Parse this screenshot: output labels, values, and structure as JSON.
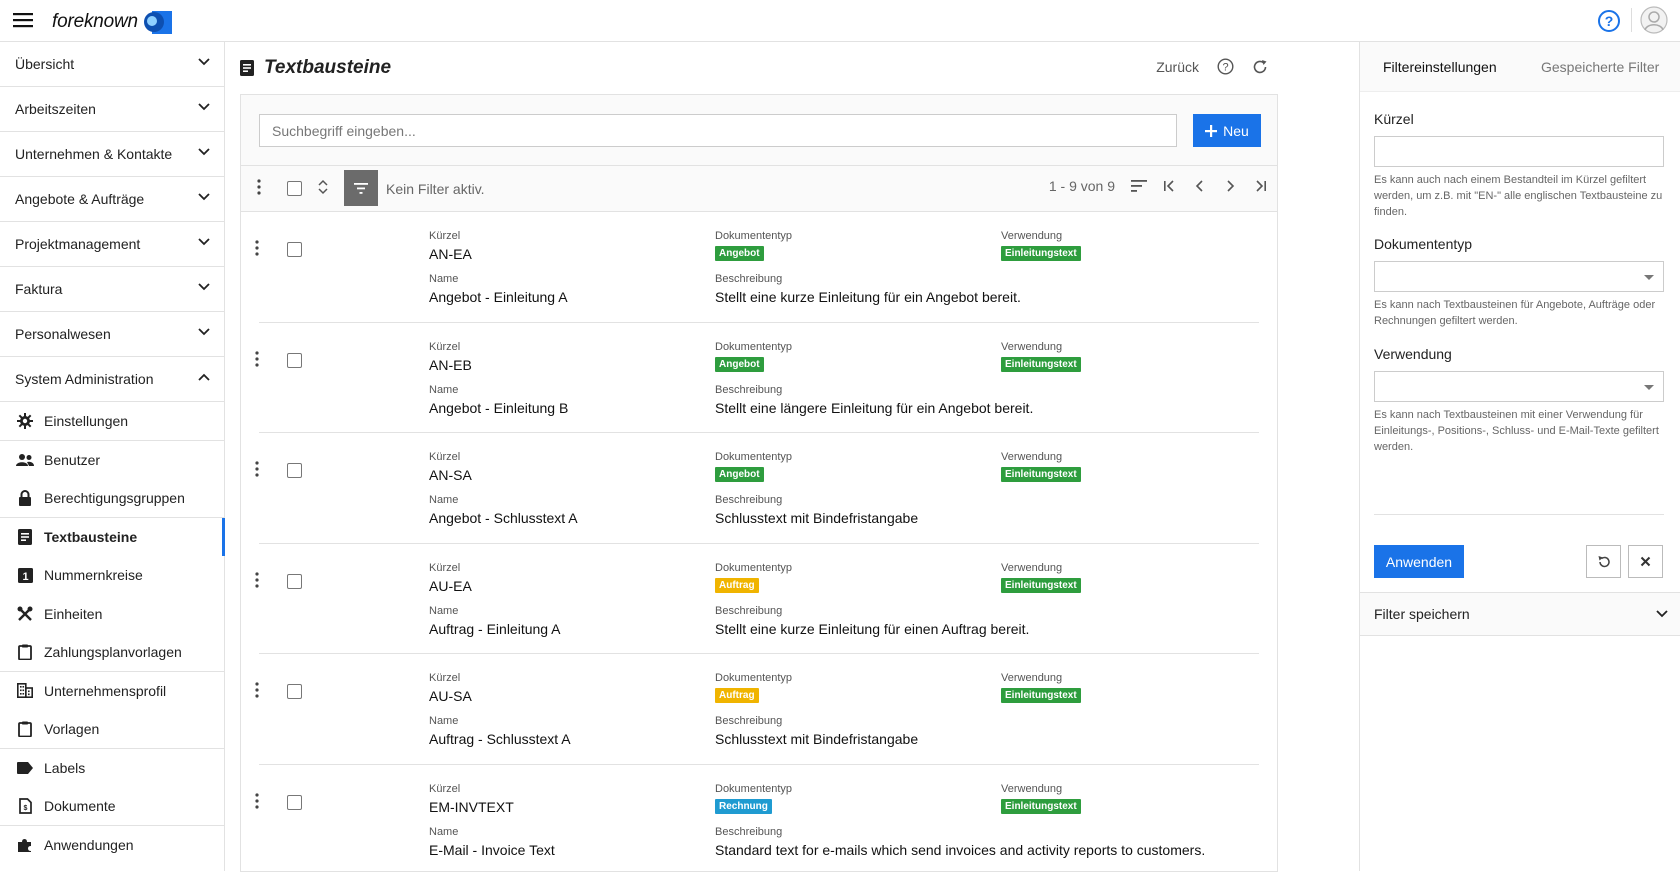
{
  "app": {
    "logo_text": "foreknown"
  },
  "colors": {
    "accent": "#1a73e8",
    "angebot": "#2e9d3e",
    "auftrag": "#f0b400",
    "rechnung": "#1f9bd1",
    "verwendung": "#2e9d3e"
  },
  "sidebar": {
    "groups": [
      {
        "label": "Übersicht"
      },
      {
        "label": "Arbeitszeiten"
      },
      {
        "label": "Unternehmen & Kontakte"
      },
      {
        "label": "Angebote & Aufträge"
      },
      {
        "label": "Projektmanagement"
      },
      {
        "label": "Faktura"
      },
      {
        "label": "Personalwesen"
      },
      {
        "label": "System Administration"
      }
    ],
    "items": [
      {
        "label": "Einstellungen",
        "icon": "gear-icon"
      },
      {
        "label": "Benutzer",
        "icon": "users-icon"
      },
      {
        "label": "Berechtigungsgruppen",
        "icon": "lock-icon"
      },
      {
        "label": "Textbausteine",
        "icon": "document-icon",
        "active": true
      },
      {
        "label": "Nummernkreise",
        "icon": "number-icon"
      },
      {
        "label": "Einheiten",
        "icon": "tools-icon"
      },
      {
        "label": "Zahlungsplanvorlagen",
        "icon": "clipboard-icon"
      },
      {
        "label": "Unternehmensprofil",
        "icon": "building-icon"
      },
      {
        "label": "Vorlagen",
        "icon": "clipboard-icon"
      },
      {
        "label": "Labels",
        "icon": "label-icon"
      },
      {
        "label": "Dokumente",
        "icon": "file-icon"
      },
      {
        "label": "Anwendungen",
        "icon": "puzzle-icon"
      }
    ]
  },
  "main": {
    "title": "Textbausteine",
    "back_label": "Zurück",
    "search_placeholder": "Suchbegriff eingeben...",
    "new_label": "Neu",
    "filter_status": "Kein Filter aktiv.",
    "pagination": "1 - 9 von 9",
    "labels": {
      "kuerzel": "Kürzel",
      "name": "Name",
      "doktyp": "Dokumententyp",
      "beschreibung": "Beschreibung",
      "verwendung": "Verwendung"
    },
    "rows": [
      {
        "kuerzel": "AN-EA",
        "name": "Angebot - Einleitung A",
        "doktyp": "Angebot",
        "beschreibung": "Stellt eine kurze Einleitung für ein Angebot bereit.",
        "verwendung": "Einleitungstext"
      },
      {
        "kuerzel": "AN-EB",
        "name": "Angebot - Einleitung B",
        "doktyp": "Angebot",
        "beschreibung": "Stellt eine längere Einleitung für ein Angebot bereit.",
        "verwendung": "Einleitungstext"
      },
      {
        "kuerzel": "AN-SA",
        "name": "Angebot - Schlusstext A",
        "doktyp": "Angebot",
        "beschreibung": "Schlusstext mit Bindefristangabe",
        "verwendung": "Einleitungstext"
      },
      {
        "kuerzel": "AU-EA",
        "name": "Auftrag - Einleitung A",
        "doktyp": "Auftrag",
        "beschreibung": "Stellt eine kurze Einleitung für einen Auftrag bereit.",
        "verwendung": "Einleitungstext"
      },
      {
        "kuerzel": "AU-SA",
        "name": "Auftrag - Schlusstext A",
        "doktyp": "Auftrag",
        "beschreibung": "Schlusstext mit Bindefristangabe",
        "verwendung": "Einleitungstext"
      },
      {
        "kuerzel": "EM-INVTEXT",
        "name": "E-Mail - Invoice Text",
        "doktyp": "Rechnung",
        "beschreibung": "Standard text for e-mails which send invoices and activity reports to customers.",
        "verwendung": "Einleitungstext"
      }
    ]
  },
  "filter": {
    "tab_settings": "Filtereinstellungen",
    "tab_saved": "Gespeicherte Filter",
    "kuerzel_label": "Kürzel",
    "kuerzel_help": "Es kann auch nach einem Bestandteil im Kürzel gefiltert werden, um z.B. mit \"EN-\" alle englischen Textbausteine zu finden.",
    "doktyp_label": "Dokumententyp",
    "doktyp_help": "Es kann nach Textbausteinen für Angebote, Aufträge oder Rechnungen gefiltert werden.",
    "verwendung_label": "Verwendung",
    "verwendung_help": "Es kann nach Textbausteinen mit einer Verwendung für Einleitungs-, Positions-, Schluss- und E-Mail-Texte gefiltert werden.",
    "apply_label": "Anwenden",
    "save_label": "Filter speichern"
  }
}
